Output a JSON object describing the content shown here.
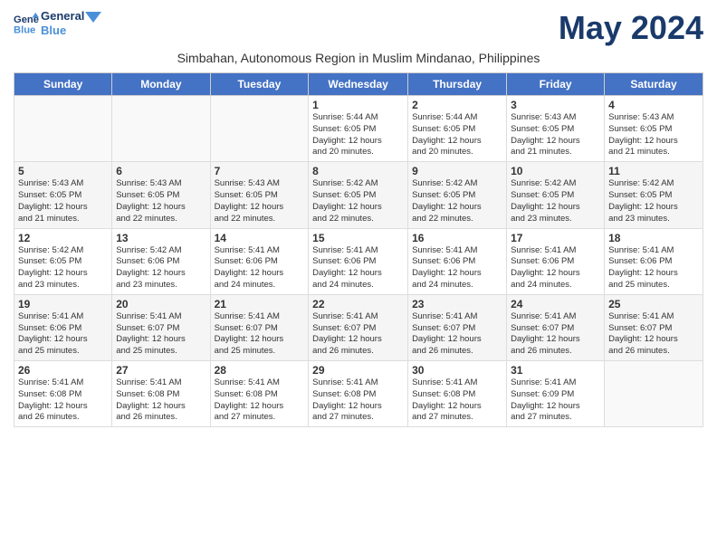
{
  "header": {
    "logo_line1": "General",
    "logo_line2": "Blue",
    "month_year": "May 2024",
    "subtitle": "Simbahan, Autonomous Region in Muslim Mindanao, Philippines"
  },
  "weekdays": [
    "Sunday",
    "Monday",
    "Tuesday",
    "Wednesday",
    "Thursday",
    "Friday",
    "Saturday"
  ],
  "weeks": [
    [
      {
        "day": "",
        "info": ""
      },
      {
        "day": "",
        "info": ""
      },
      {
        "day": "",
        "info": ""
      },
      {
        "day": "1",
        "info": "Sunrise: 5:44 AM\nSunset: 6:05 PM\nDaylight: 12 hours\nand 20 minutes."
      },
      {
        "day": "2",
        "info": "Sunrise: 5:44 AM\nSunset: 6:05 PM\nDaylight: 12 hours\nand 20 minutes."
      },
      {
        "day": "3",
        "info": "Sunrise: 5:43 AM\nSunset: 6:05 PM\nDaylight: 12 hours\nand 21 minutes."
      },
      {
        "day": "4",
        "info": "Sunrise: 5:43 AM\nSunset: 6:05 PM\nDaylight: 12 hours\nand 21 minutes."
      }
    ],
    [
      {
        "day": "5",
        "info": "Sunrise: 5:43 AM\nSunset: 6:05 PM\nDaylight: 12 hours\nand 21 minutes."
      },
      {
        "day": "6",
        "info": "Sunrise: 5:43 AM\nSunset: 6:05 PM\nDaylight: 12 hours\nand 22 minutes."
      },
      {
        "day": "7",
        "info": "Sunrise: 5:43 AM\nSunset: 6:05 PM\nDaylight: 12 hours\nand 22 minutes."
      },
      {
        "day": "8",
        "info": "Sunrise: 5:42 AM\nSunset: 6:05 PM\nDaylight: 12 hours\nand 22 minutes."
      },
      {
        "day": "9",
        "info": "Sunrise: 5:42 AM\nSunset: 6:05 PM\nDaylight: 12 hours\nand 22 minutes."
      },
      {
        "day": "10",
        "info": "Sunrise: 5:42 AM\nSunset: 6:05 PM\nDaylight: 12 hours\nand 23 minutes."
      },
      {
        "day": "11",
        "info": "Sunrise: 5:42 AM\nSunset: 6:05 PM\nDaylight: 12 hours\nand 23 minutes."
      }
    ],
    [
      {
        "day": "12",
        "info": "Sunrise: 5:42 AM\nSunset: 6:05 PM\nDaylight: 12 hours\nand 23 minutes."
      },
      {
        "day": "13",
        "info": "Sunrise: 5:42 AM\nSunset: 6:06 PM\nDaylight: 12 hours\nand 23 minutes."
      },
      {
        "day": "14",
        "info": "Sunrise: 5:41 AM\nSunset: 6:06 PM\nDaylight: 12 hours\nand 24 minutes."
      },
      {
        "day": "15",
        "info": "Sunrise: 5:41 AM\nSunset: 6:06 PM\nDaylight: 12 hours\nand 24 minutes."
      },
      {
        "day": "16",
        "info": "Sunrise: 5:41 AM\nSunset: 6:06 PM\nDaylight: 12 hours\nand 24 minutes."
      },
      {
        "day": "17",
        "info": "Sunrise: 5:41 AM\nSunset: 6:06 PM\nDaylight: 12 hours\nand 24 minutes."
      },
      {
        "day": "18",
        "info": "Sunrise: 5:41 AM\nSunset: 6:06 PM\nDaylight: 12 hours\nand 25 minutes."
      }
    ],
    [
      {
        "day": "19",
        "info": "Sunrise: 5:41 AM\nSunset: 6:06 PM\nDaylight: 12 hours\nand 25 minutes."
      },
      {
        "day": "20",
        "info": "Sunrise: 5:41 AM\nSunset: 6:07 PM\nDaylight: 12 hours\nand 25 minutes."
      },
      {
        "day": "21",
        "info": "Sunrise: 5:41 AM\nSunset: 6:07 PM\nDaylight: 12 hours\nand 25 minutes."
      },
      {
        "day": "22",
        "info": "Sunrise: 5:41 AM\nSunset: 6:07 PM\nDaylight: 12 hours\nand 26 minutes."
      },
      {
        "day": "23",
        "info": "Sunrise: 5:41 AM\nSunset: 6:07 PM\nDaylight: 12 hours\nand 26 minutes."
      },
      {
        "day": "24",
        "info": "Sunrise: 5:41 AM\nSunset: 6:07 PM\nDaylight: 12 hours\nand 26 minutes."
      },
      {
        "day": "25",
        "info": "Sunrise: 5:41 AM\nSunset: 6:07 PM\nDaylight: 12 hours\nand 26 minutes."
      }
    ],
    [
      {
        "day": "26",
        "info": "Sunrise: 5:41 AM\nSunset: 6:08 PM\nDaylight: 12 hours\nand 26 minutes."
      },
      {
        "day": "27",
        "info": "Sunrise: 5:41 AM\nSunset: 6:08 PM\nDaylight: 12 hours\nand 26 minutes."
      },
      {
        "day": "28",
        "info": "Sunrise: 5:41 AM\nSunset: 6:08 PM\nDaylight: 12 hours\nand 27 minutes."
      },
      {
        "day": "29",
        "info": "Sunrise: 5:41 AM\nSunset: 6:08 PM\nDaylight: 12 hours\nand 27 minutes."
      },
      {
        "day": "30",
        "info": "Sunrise: 5:41 AM\nSunset: 6:08 PM\nDaylight: 12 hours\nand 27 minutes."
      },
      {
        "day": "31",
        "info": "Sunrise: 5:41 AM\nSunset: 6:09 PM\nDaylight: 12 hours\nand 27 minutes."
      },
      {
        "day": "",
        "info": ""
      }
    ]
  ]
}
